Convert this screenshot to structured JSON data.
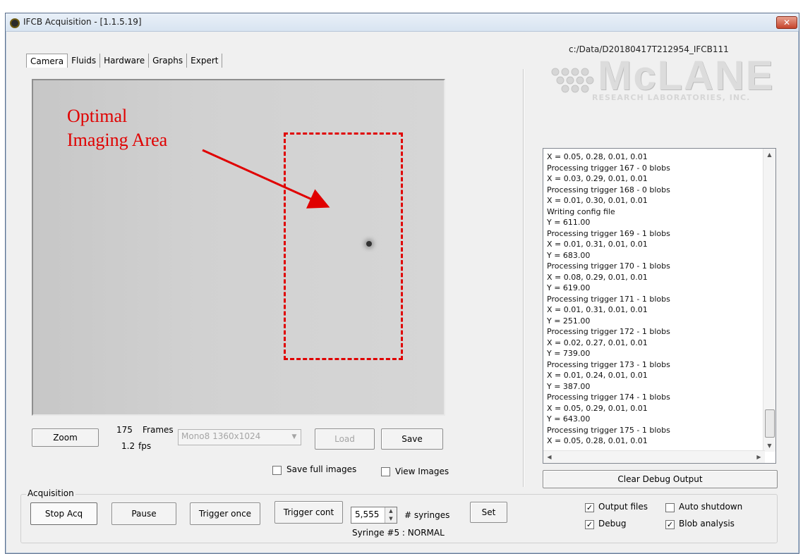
{
  "window": {
    "title": "IFCB Acquisition - [1.1.5.19]",
    "close_label": "✕"
  },
  "tabs": [
    "Camera",
    "Fluids",
    "Hardware",
    "Graphs",
    "Expert"
  ],
  "camera": {
    "annotation_line1": "Optimal",
    "annotation_line2": "Imaging Area",
    "frames_count": "175",
    "frames_label": "Frames",
    "fps_value": "1.2",
    "fps_label": "fps",
    "zoom_label": "Zoom",
    "mode_select": "Mono8 1360x1024",
    "load_label": "Load",
    "save_label": "Save",
    "save_full_images_label": "Save full images",
    "view_images_label": "View Images"
  },
  "right_panel": {
    "data_path": "c:/Data/D20180417T212954_IFCB111",
    "logo_main": "McLANE",
    "logo_sub": "RESEARCH LABORATORIES, INC.",
    "debug_lines": [
      "X = 0.05, 0.28, 0.01, 0.01",
      "Processing trigger 167 - 0 blobs",
      "X = 0.03, 0.29, 0.01, 0.01",
      "Processing trigger 168 - 0 blobs",
      "X = 0.01, 0.30, 0.01, 0.01",
      "Writing config file",
      "Y = 611.00",
      "Processing trigger 169 - 1 blobs",
      "X = 0.01, 0.31, 0.01, 0.01",
      "Y = 683.00",
      "Processing trigger 170 - 1 blobs",
      "X = 0.08, 0.29, 0.01, 0.01",
      "Y = 619.00",
      "Processing trigger 171 - 1 blobs",
      "X = 0.01, 0.31, 0.01, 0.01",
      "Y = 251.00",
      "Processing trigger 172 - 1 blobs",
      "X = 0.02, 0.27, 0.01, 0.01",
      "Y = 739.00",
      "Processing trigger 173 - 1 blobs",
      "X = 0.01, 0.24, 0.01, 0.01",
      "Y = 387.00",
      "Processing trigger 174 - 1 blobs",
      "X = 0.05, 0.29, 0.01, 0.01",
      "Y = 643.00",
      "Processing trigger 175 - 1 blobs",
      "X = 0.05, 0.28, 0.01, 0.01"
    ],
    "clear_debug_label": "Clear Debug Output"
  },
  "acquisition": {
    "group_label": "Acquisition",
    "stop_acq_label": "Stop Acq",
    "pause_label": "Pause",
    "trigger_once_label": "Trigger once",
    "trigger_cont_label": "Trigger cont",
    "syringes_value": "5,555",
    "syringes_label": "# syringes",
    "set_label": "Set",
    "syringe_status": "Syringe #5 : NORMAL"
  },
  "options": {
    "output_files": {
      "label": "Output files",
      "checked": true
    },
    "auto_shutdown": {
      "label": "Auto shutdown",
      "checked": false
    },
    "debug": {
      "label": "Debug",
      "checked": true
    },
    "blob_analysis": {
      "label": "Blob analysis",
      "checked": true
    }
  },
  "colors": {
    "annotation": "#e00000",
    "window_bg": "#f0f0f0"
  }
}
